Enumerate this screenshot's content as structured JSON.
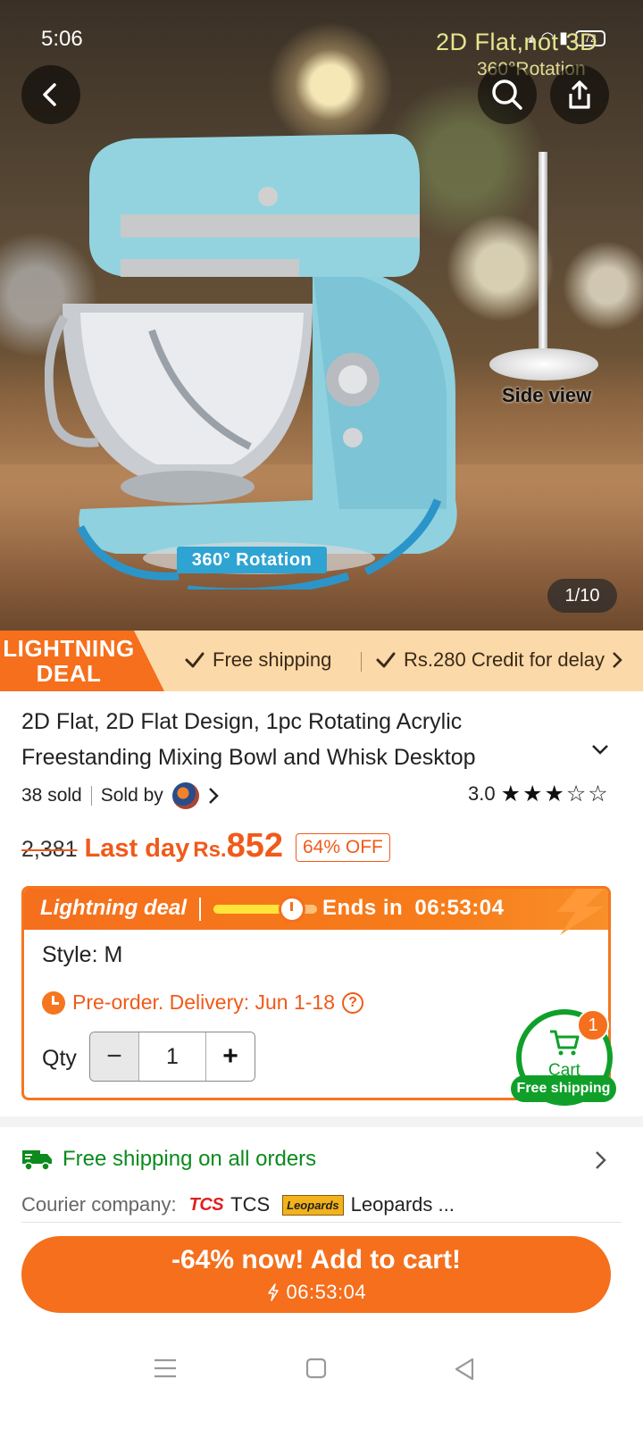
{
  "status_bar": {
    "time": "5:06",
    "battery": "72"
  },
  "hero": {
    "overlay_line1": "2D Flat,not 3D",
    "overlay_line2": "360°Rotation",
    "side_view_label": "Side view",
    "rotation_label": "360° Rotation",
    "image_counter": "1/10"
  },
  "deal_banner": {
    "tag_line1": "LIGHTNING",
    "tag_line2": "DEAL",
    "perk1": "Free shipping",
    "perk2": "Rs.280 Credit for delay"
  },
  "product": {
    "title": "2D Flat, 2D Flat Design, 1pc Rotating Acrylic Freestanding Mixing Bowl and Whisk Desktop",
    "sold": "38 sold",
    "sold_by": "Sold by",
    "rating": "3.0",
    "rating_value": 3,
    "rating_max": 5
  },
  "price": {
    "original": "2,381",
    "last_day": "Last day",
    "currency": "Rs.",
    "current": "852",
    "discount": "64% OFF"
  },
  "lightning_deal": {
    "title": "Lightning deal",
    "progress_fraction": 0.7,
    "ends_in_label": "Ends in",
    "countdown": "06:53:04",
    "style_label": "Style: M",
    "preorder": "Pre-order. Delivery: Jun 1-18",
    "help_glyph": "?",
    "qty_label": "Qty",
    "qty_value": "1",
    "minus_glyph": "−",
    "plus_glyph": "+"
  },
  "cart": {
    "count": "1",
    "label": "Cart",
    "free_shipping": "Free shipping"
  },
  "shipping": {
    "headline": "Free shipping on all orders",
    "courier_label": "Courier company:",
    "courier1_logo": "TCS",
    "courier1": "TCS",
    "courier2_logo": "Leopards",
    "courier2": "Leopards ..."
  },
  "cta": {
    "main": "-64% now! Add to cart!",
    "timer": "06:53:04"
  },
  "colors": {
    "accent": "#f56f1c",
    "green": "#10a02a",
    "banner_bg": "#fcd9a8"
  },
  "icons": [
    "back-icon",
    "search-icon",
    "share-icon",
    "check-icon",
    "chevron-down-icon",
    "chevron-right-icon",
    "star-icon",
    "clock-icon",
    "help-icon",
    "cart-icon",
    "truck-icon",
    "bolt-icon",
    "menu-icon",
    "home-icon",
    "back-nav-icon"
  ]
}
